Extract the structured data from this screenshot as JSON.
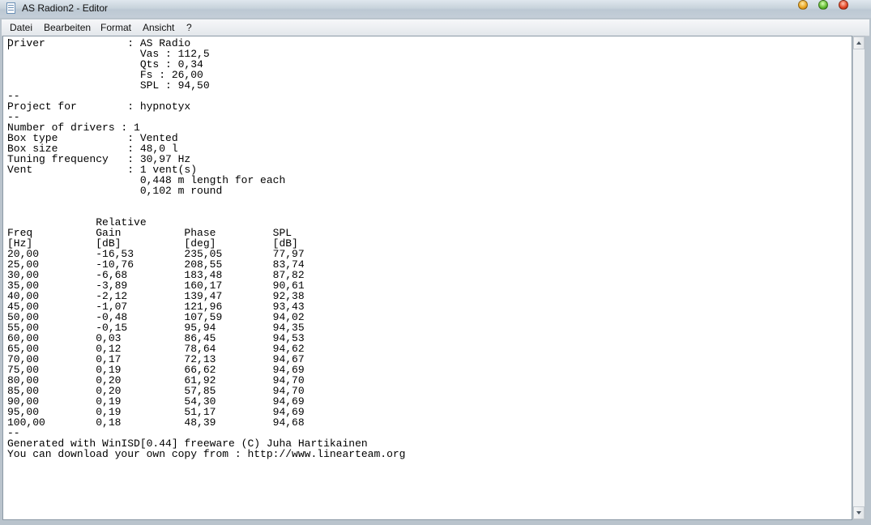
{
  "window": {
    "title": "AS Radion2 - Editor"
  },
  "menu": {
    "items": [
      "Datei",
      "Bearbeiten",
      "Format",
      "Ansicht",
      "?"
    ]
  },
  "document": {
    "text": "Driver             : AS Radio\n                     Vas : 112,5\n                     Qts : 0,34\n                     Fs : 26,00\n                     SPL : 94,50\n--\nProject for        : hypnotyx\n--\nNumber of drivers : 1\nBox type           : Vented\nBox size           : 48,0 l\nTuning frequency   : 30,97 Hz\nVent               : 1 vent(s)\n                     0,448 m length for each\n                     0,102 m round\n\n\n              Relative\nFreq          Gain          Phase         SPL\n[Hz]          [dB]          [deg]         [dB]\n20,00         -16,53        235,05        77,97\n25,00         -10,76        208,55        83,74\n30,00         -6,68         183,48        87,82\n35,00         -3,89         160,17        90,61\n40,00         -2,12         139,47        92,38\n45,00         -1,07         121,96        93,43\n50,00         -0,48         107,59        94,02\n55,00         -0,15         95,94         94,35\n60,00         0,03          86,45         94,53\n65,00         0,12          78,64         94,62\n70,00         0,17          72,13         94,67\n75,00         0,19          66,62         94,69\n80,00         0,20          61,92         94,70\n85,00         0,20          57,85         94,70\n90,00         0,19          54,30         94,69\n95,00         0,19          51,17         94,69\n100,00        0,18          48,39         94,68\n--\nGenerated with WinISD[0.44] freeware (C) Juha Hartikainen\nYou can download your own copy from : http://www.linearteam.org"
  }
}
